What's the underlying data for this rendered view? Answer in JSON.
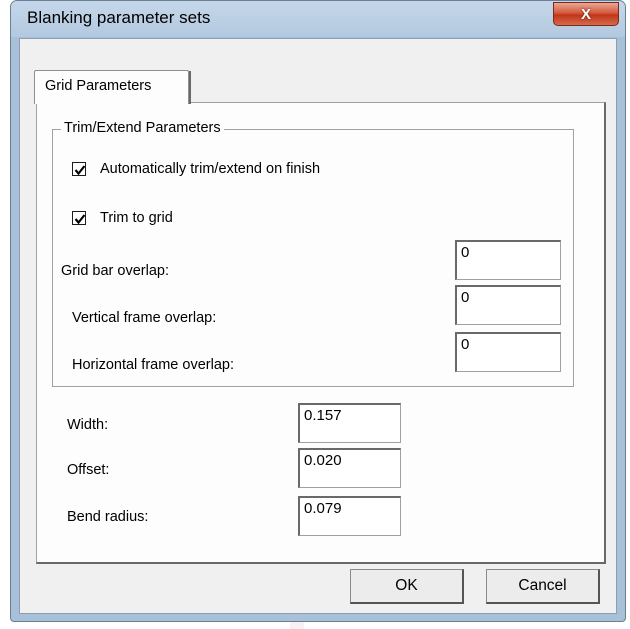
{
  "window": {
    "title": "Blanking parameter sets",
    "close_glyph": "X"
  },
  "tabs": [
    {
      "label": "Grid Parameters"
    }
  ],
  "trim_group": {
    "legend": "Trim/Extend Parameters",
    "checkboxes": [
      {
        "label": "Automatically trim/extend on finish",
        "checked": true
      },
      {
        "label": "Trim to grid",
        "checked": true
      }
    ],
    "fields": [
      {
        "label": "Grid bar overlap:",
        "value": "0"
      },
      {
        "label": "Vertical frame overlap:",
        "value": "0"
      },
      {
        "label": "Horizontal frame overlap:",
        "value": "0"
      }
    ]
  },
  "fields": [
    {
      "label": "Width:",
      "value": "0.157"
    },
    {
      "label": "Offset:",
      "value": "0.020"
    },
    {
      "label": "Bend radius:",
      "value": "0.079"
    }
  ],
  "buttons": {
    "ok": "OK",
    "cancel": "Cancel"
  }
}
